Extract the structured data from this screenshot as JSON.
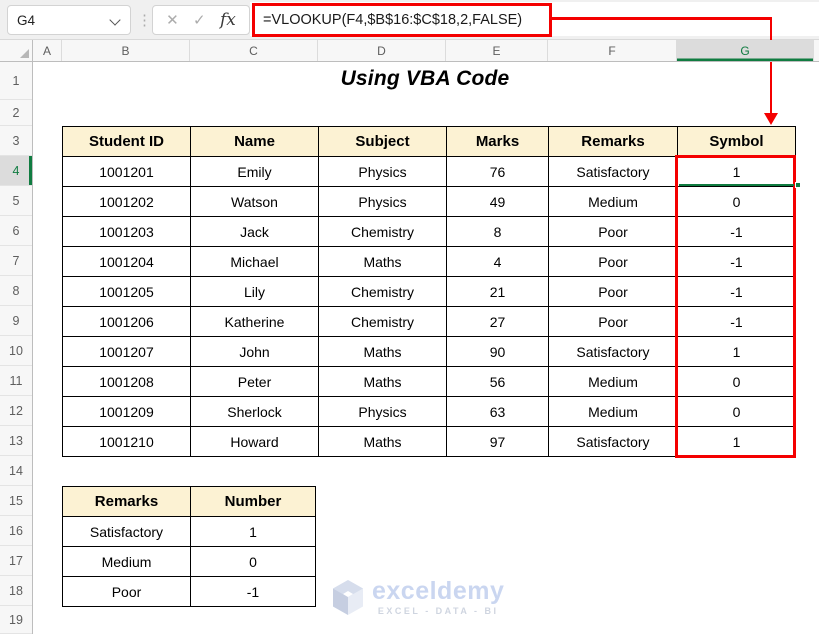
{
  "formula_bar": {
    "cell_reference": "G4",
    "formula": "=VLOOKUP(F4,$B$16:$C$18,2,FALSE)",
    "cancel_icon": "✕",
    "enter_icon": "✓",
    "fx_label": "fx",
    "dots_icon": "⋮"
  },
  "spreadsheet": {
    "column_labels": [
      "A",
      "B",
      "C",
      "D",
      "E",
      "F",
      "G"
    ],
    "selected_column": "G",
    "row_numbers": [
      "1",
      "2",
      "3",
      "4",
      "5",
      "6",
      "7",
      "8",
      "9",
      "10",
      "11",
      "12",
      "13",
      "14",
      "15",
      "16",
      "17",
      "18",
      "19"
    ],
    "selected_row": "4"
  },
  "title": "Using VBA Code",
  "main_table": {
    "headers": [
      "Student ID",
      "Name",
      "Subject",
      "Marks",
      "Remarks",
      "Symbol"
    ],
    "rows": [
      [
        "1001201",
        "Emily",
        "Physics",
        "76",
        "Satisfactory",
        "1"
      ],
      [
        "1001202",
        "Watson",
        "Physics",
        "49",
        "Medium",
        "0"
      ],
      [
        "1001203",
        "Jack",
        "Chemistry",
        "8",
        "Poor",
        "-1"
      ],
      [
        "1001204",
        "Michael",
        "Maths",
        "4",
        "Poor",
        "-1"
      ],
      [
        "1001205",
        "Lily",
        "Chemistry",
        "21",
        "Poor",
        "-1"
      ],
      [
        "1001206",
        "Katherine",
        "Chemistry",
        "27",
        "Poor",
        "-1"
      ],
      [
        "1001207",
        "John",
        "Maths",
        "90",
        "Satisfactory",
        "1"
      ],
      [
        "1001208",
        "Peter",
        "Maths",
        "56",
        "Medium",
        "0"
      ],
      [
        "1001209",
        "Sherlock",
        "Physics",
        "63",
        "Medium",
        "0"
      ],
      [
        "1001210",
        "Howard",
        "Maths",
        "97",
        "Satisfactory",
        "1"
      ]
    ]
  },
  "lookup_table": {
    "headers": [
      "Remarks",
      "Number"
    ],
    "rows": [
      [
        "Satisfactory",
        "1"
      ],
      [
        "Medium",
        "0"
      ],
      [
        "Poor",
        "-1"
      ]
    ]
  },
  "watermark": {
    "brand": "exceldemy",
    "tagline": "EXCEL - DATA - BI"
  },
  "colors": {
    "annotation_red": "#F40000",
    "excel_green": "#107C41",
    "table_header_fill": "#FCF2D3",
    "selected_header_gray": "#DCDCDC",
    "watermark_blue": "#C8D4F0"
  }
}
